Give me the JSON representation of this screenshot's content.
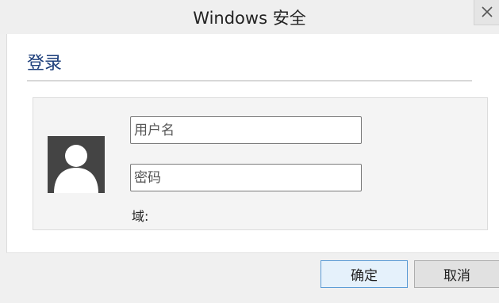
{
  "window": {
    "title": "Windows 安全",
    "close_icon": "close-icon"
  },
  "dialog": {
    "heading": "登录",
    "avatar_icon": "user-avatar-icon",
    "username": {
      "value": "",
      "placeholder": "用户名"
    },
    "password": {
      "value": "",
      "placeholder": "密码"
    },
    "domain_label": "域:"
  },
  "buttons": {
    "ok_label": "确定",
    "cancel_label": "取消"
  },
  "colors": {
    "heading": "#1b3d7a",
    "ok_border": "#5b9bd5",
    "avatar_bg": "#444444"
  }
}
